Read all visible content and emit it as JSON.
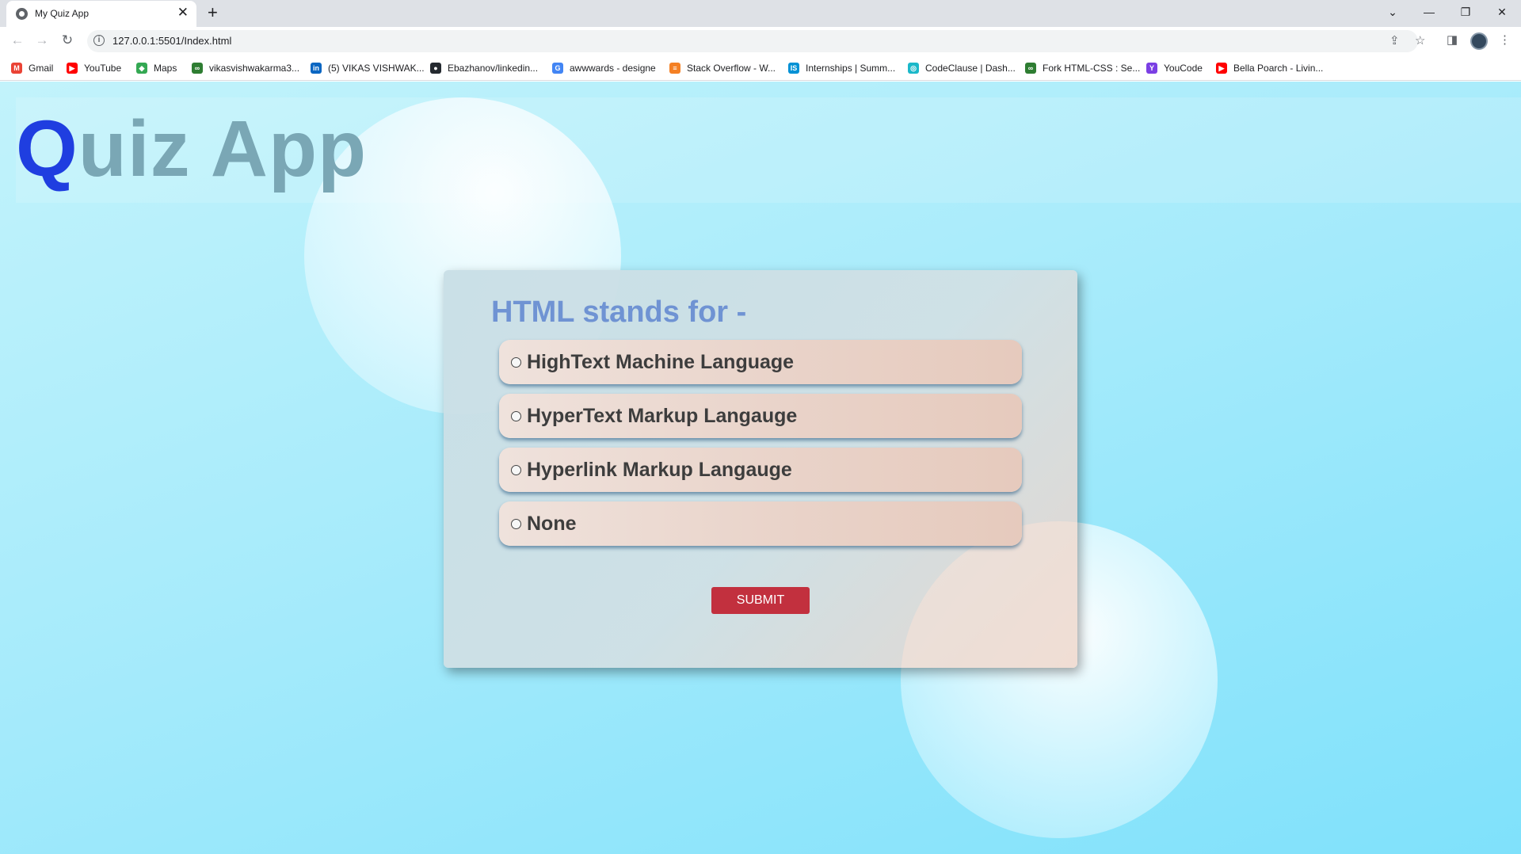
{
  "browser": {
    "tab_title": "My Quiz App",
    "tab_close": "✕",
    "new_tab": "+",
    "window_controls": [
      "⌄",
      "—",
      "❐",
      "✕"
    ],
    "back": "←",
    "forward": "→",
    "reload": "↻",
    "info": "i",
    "url": "127.0.0.1:5501/Index.html",
    "share": "⇪",
    "star": "☆",
    "side_panel": "◨",
    "menu": "⋮"
  },
  "bookmarks": [
    {
      "label": "Gmail",
      "icon": "M",
      "color": "#ea4335"
    },
    {
      "label": "YouTube",
      "icon": "▶",
      "color": "#ff0000"
    },
    {
      "label": "Maps",
      "icon": "◆",
      "color": "#34a853"
    },
    {
      "label": "vikasvishwakarma3...",
      "icon": "∞",
      "color": "#2e7d32"
    },
    {
      "label": "(5) VIKAS VISHWAK...",
      "icon": "in",
      "color": "#0a66c2"
    },
    {
      "label": "Ebazhanov/linkedin...",
      "icon": "●",
      "color": "#24292f"
    },
    {
      "label": "awwwards - designe",
      "icon": "G",
      "color": "#4285f4"
    },
    {
      "label": "Stack Overflow - W...",
      "icon": "≡",
      "color": "#f48024"
    },
    {
      "label": "Internships | Summ...",
      "icon": "IS",
      "color": "#0091d5"
    },
    {
      "label": "CodeClause | Dash...",
      "icon": "◎",
      "color": "#1bb8c9"
    },
    {
      "label": "Fork HTML-CSS : Se...",
      "icon": "∞",
      "color": "#2e7d32"
    },
    {
      "label": "YouCode",
      "icon": "Y",
      "color": "#7b3fe4"
    },
    {
      "label": "Bella Poarch - Livin...",
      "icon": "▶",
      "color": "#ff0000"
    }
  ],
  "app": {
    "title_first": "Q",
    "title_rest": "uiz App",
    "question": "HTML stands for -",
    "options": [
      "HighText Machine Language",
      "HyperText Markup Langauge",
      "Hyperlink Markup Langauge",
      "None"
    ],
    "submit_label": "SUBMIT"
  }
}
